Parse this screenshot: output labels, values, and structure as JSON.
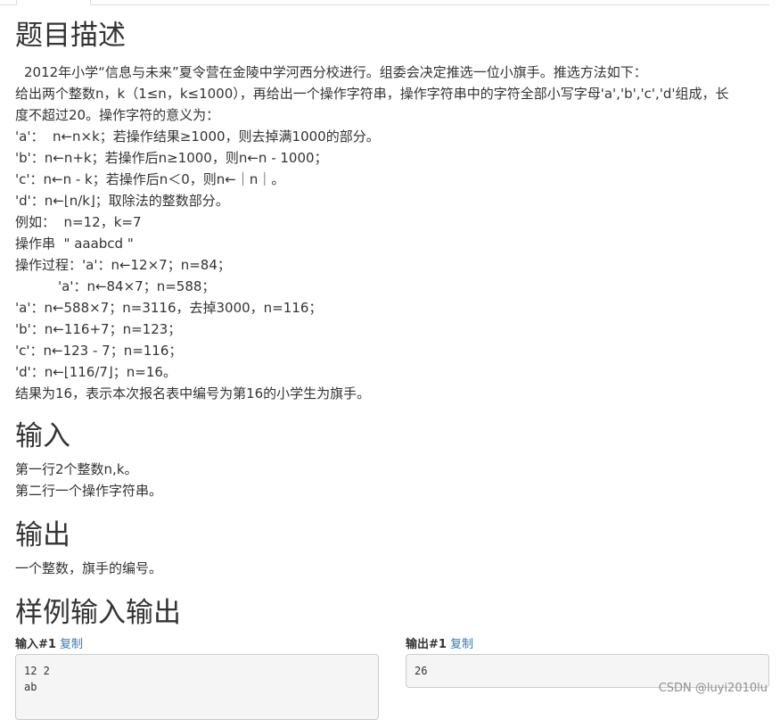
{
  "sections": {
    "description_title": "题目描述",
    "input_title": "输入",
    "output_title": "输出",
    "sample_title": "样例输入输出"
  },
  "description_lines": [
    "2012年小学“信息与未来”夏令营在金陵中学河西分校进行。组委会决定推选一位小旗手。推选方法如下：",
    "给出两个整数n，k（1≤n，k≤1000），再给出一个操作字符串，操作字符串中的字符全部小写字母'a','b','c','d'组成，长",
    "度不超过20。操作字符的意义为：",
    "'a'：  n←n×k；若操作结果≥1000，则去掉满1000的部分。",
    "'b'：n←n+k；若操作后n≥1000，则n←n - 1000；",
    "'c'：n←n - k；若操作后n＜0，则n←｜n｜。",
    "'d'：n←⌊n/k⌋；取除法的整数部分。",
    "例如：  n=12，k=7",
    "操作串  \" aaabcd \"",
    "操作过程：'a'：n←12×7；n=84；",
    "'a'：n←84×7；n=588；",
    "'a'：n←588×7；n=3116，去掉3000，n=116；",
    "'b'：n←116+7；n=123；",
    "'c'：n←123 - 7；n=116；",
    "'d'：n←⌊116/7⌋；n=16。",
    "结果为16，表示本次报名表中编号为第16的小学生为旗手。"
  ],
  "input_lines": [
    "第一行2个整数n,k。",
    "第二行一个操作字符串。"
  ],
  "output_lines": [
    "一个整数，旗手的编号。"
  ],
  "sample": {
    "input_label": "输入#1",
    "output_label": "输出#1",
    "copy_label": "复制",
    "input_lines": [
      "12 2",
      "ab"
    ],
    "output_lines": [
      "26"
    ]
  },
  "watermark": "CSDN @luyi2010lu",
  "colors": {
    "link": "#337ab7",
    "pre_bg": "#f5f5f5",
    "border": "#cccccc"
  }
}
